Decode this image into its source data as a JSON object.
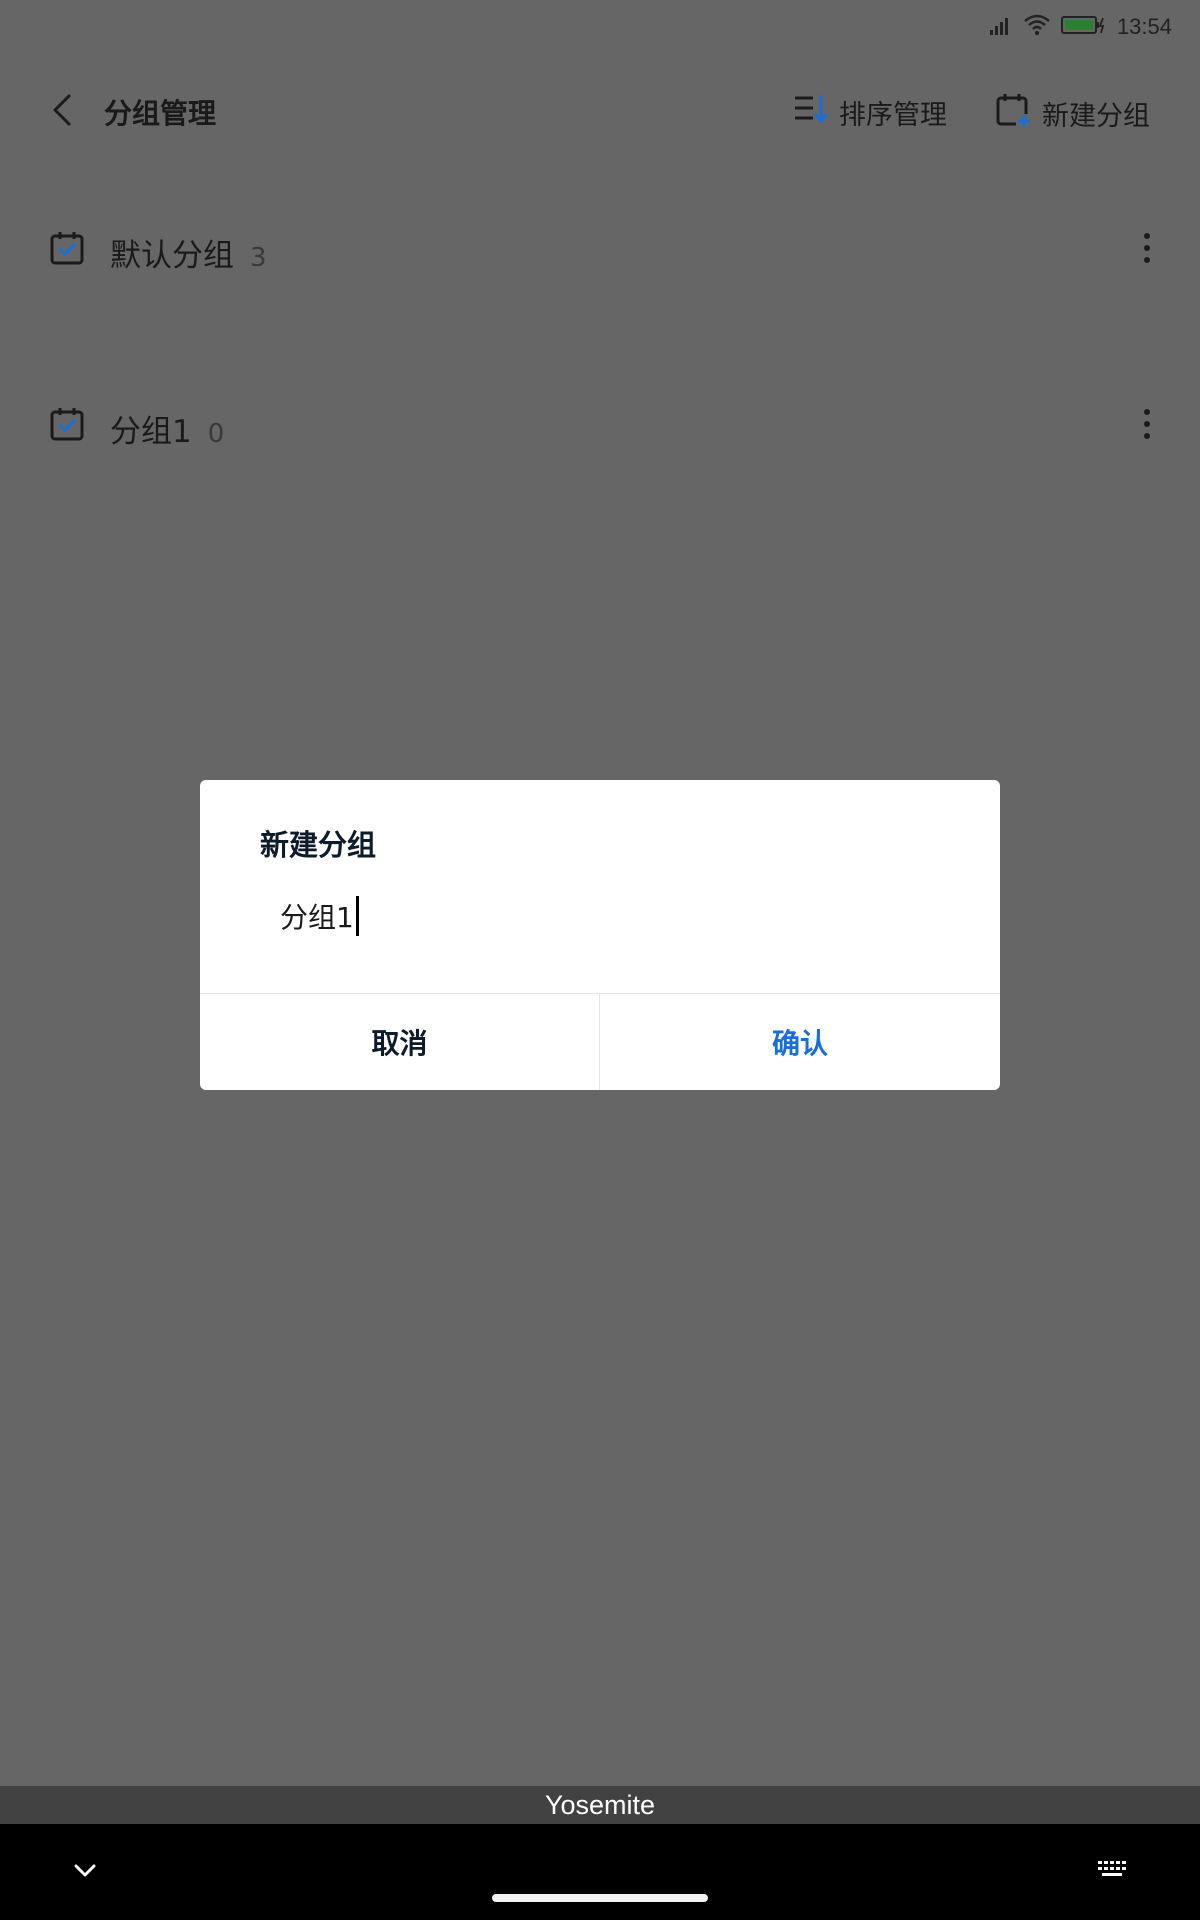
{
  "status_bar": {
    "time": "13:54",
    "icons": [
      "signal-icon",
      "wifi-icon",
      "battery-charging-icon"
    ]
  },
  "header": {
    "title": "分组管理",
    "back_icon": "back-arrow-icon",
    "sort_label": "排序管理",
    "sort_icon": "sort-list-icon",
    "new_group_label": "新建分组",
    "new_group_icon": "add-calendar-icon"
  },
  "groups": [
    {
      "name": "默认分组",
      "count": "3"
    },
    {
      "name": "分组1",
      "count": "0"
    }
  ],
  "dialog": {
    "title": "新建分组",
    "input_value": "分组1",
    "cancel_label": "取消",
    "confirm_label": "确认"
  },
  "keyboard_hint": {
    "text": "Yosemite"
  },
  "nav_bar": {
    "collapse_icon": "chevron-down-icon",
    "keyboard_icon": "keyboard-icon"
  },
  "colors": {
    "overlay_background": "#666666",
    "accent": "#1a6fd6",
    "dialog_background": "#ffffff",
    "battery": "#2e7d32"
  }
}
